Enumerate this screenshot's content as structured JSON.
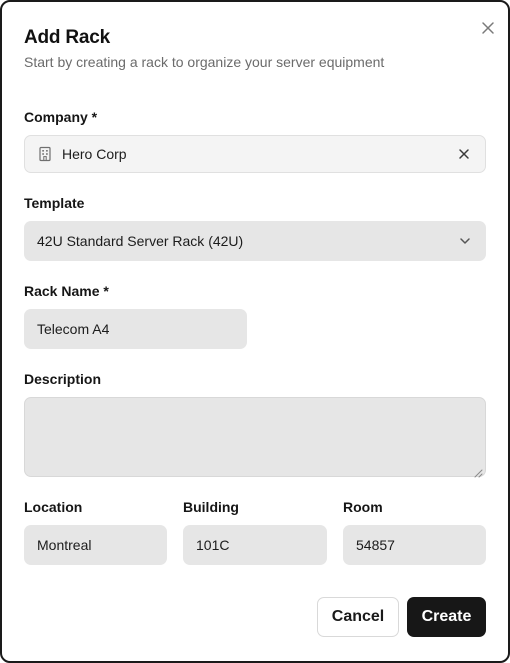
{
  "dialog": {
    "title": "Add Rack",
    "subtitle": "Start by creating a rack to organize your server equipment",
    "close_icon": "close-icon"
  },
  "form": {
    "company": {
      "label": "Company *",
      "value": "Hero Corp",
      "icon": "building-icon",
      "clear_icon": "close-icon"
    },
    "template": {
      "label": "Template",
      "value": "42U Standard Server Rack (42U)",
      "icon": "chevron-down-icon"
    },
    "rack_name": {
      "label": "Rack Name *",
      "value": "Telecom A4"
    },
    "description": {
      "label": "Description",
      "value": ""
    },
    "location": {
      "label": "Location",
      "value": "Montreal"
    },
    "building": {
      "label": "Building",
      "value": "101C"
    },
    "room": {
      "label": "Room",
      "value": "54857"
    }
  },
  "actions": {
    "cancel_label": "Cancel",
    "create_label": "Create"
  },
  "colors": {
    "primary_button": "#171717",
    "field_background": "#e6e6e6",
    "subtitle_text": "#6b6b6b"
  }
}
